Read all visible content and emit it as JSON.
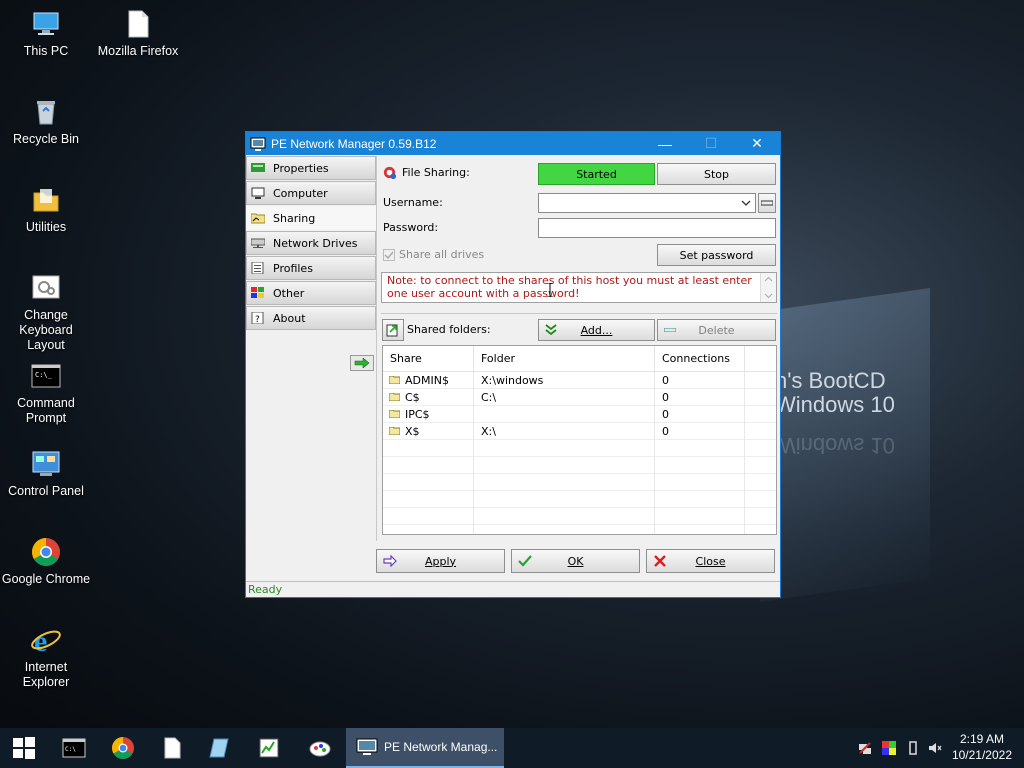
{
  "desktop": {
    "background_text": [
      "n's BootCD",
      "Windows 10"
    ],
    "icons": [
      {
        "label": "This PC",
        "icon": "this-pc-icon"
      },
      {
        "label": "Mozilla Firefox",
        "icon": "file-icon"
      },
      {
        "label": "Recycle Bin",
        "icon": "recycle-bin-icon"
      },
      {
        "label": "Utilities",
        "icon": "folder-icon"
      },
      {
        "label": "Change Keyboard Layout",
        "icon": "keyboard-settings-icon"
      },
      {
        "label": "Command Prompt",
        "icon": "command-prompt-icon"
      },
      {
        "label": "Control Panel",
        "icon": "control-panel-icon"
      },
      {
        "label": "Google Chrome",
        "icon": "chrome-icon"
      },
      {
        "label": "Internet Explorer",
        "icon": "internet-explorer-icon"
      }
    ]
  },
  "window": {
    "title": "PE Network Manager 0.59.B12",
    "sidebar": [
      {
        "label": "Properties"
      },
      {
        "label": "Computer"
      },
      {
        "label": "Sharing"
      },
      {
        "label": "Network Drives"
      },
      {
        "label": "Profiles"
      },
      {
        "label": "Other"
      },
      {
        "label": "About"
      }
    ],
    "active_tab": "Sharing",
    "sharing": {
      "file_sharing_label": "File Sharing:",
      "status": "Started",
      "stop_label": "Stop",
      "username_label": "Username:",
      "username_value": "",
      "password_label": "Password:",
      "password_value": "",
      "share_all_label": "Share all drives",
      "share_all_checked": true,
      "set_password_label": "Set password",
      "note": "Note: to connect to the shares of this host you must at least enter one user account with a password!",
      "shared_folders_label": "Shared folders:",
      "add_label": "Add...",
      "delete_label": "Delete",
      "columns": [
        "Share",
        "Folder",
        "Connections"
      ],
      "rows": [
        {
          "share": "ADMIN$",
          "folder": "X:\\windows",
          "connections": "0"
        },
        {
          "share": "C$",
          "folder": "C:\\",
          "connections": "0"
        },
        {
          "share": "IPC$",
          "folder": "",
          "connections": "0"
        },
        {
          "share": "X$",
          "folder": "X:\\",
          "connections": "0"
        }
      ]
    },
    "footer": {
      "apply": "Apply",
      "ok": "OK",
      "close": "Close"
    },
    "status": "Ready"
  },
  "taskbar": {
    "active_task": "PE Network Manag...",
    "time": "2:19 AM",
    "date": "10/21/2022"
  },
  "colors": {
    "title_bar": "#1883d7",
    "started_green": "#42d742",
    "note_red": "#b01818",
    "status_green": "#2a8a2a",
    "taskbar": "#101b28"
  }
}
